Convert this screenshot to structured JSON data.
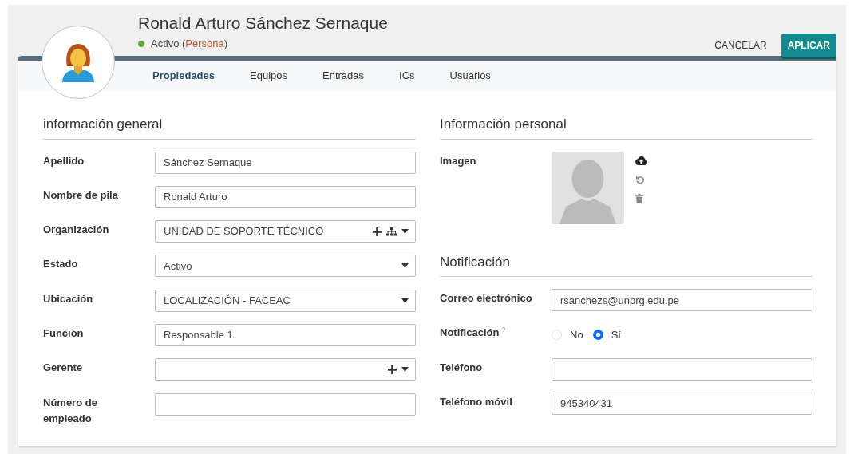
{
  "header": {
    "name": "Ronald Arturo Sánchez Sernaque",
    "status": {
      "text": "Activo",
      "color": "#6aaa3a"
    },
    "type": {
      "open": "(",
      "text": "Persona",
      "close": ")"
    }
  },
  "buttons": [
    {
      "label": "CANCELAR",
      "kind": "link"
    },
    {
      "label": "APLICAR",
      "kind": "primary"
    }
  ],
  "tabs": [
    {
      "label": "Propiedades",
      "selected": true
    },
    {
      "label": "Equipos",
      "selected": false
    },
    {
      "label": "Entradas",
      "selected": false
    },
    {
      "label": "ICs",
      "selected": false
    },
    {
      "label": "Usuarios",
      "selected": false
    }
  ],
  "columns": [
    {
      "sections": [
        {
          "title": "información general",
          "fields": [
            {
              "label": "Apellido",
              "kind": "text",
              "value": "Sánchez Sernaque"
            },
            {
              "label": "Nombre de pila",
              "kind": "text",
              "value": "Ronald Arturo"
            },
            {
              "label": "Organización",
              "kind": "org-picker",
              "value": "UNIDAD DE SOPORTE TÉCNICO"
            },
            {
              "label": "Estado",
              "kind": "select",
              "value": "Activo"
            },
            {
              "label": "Ubicación",
              "kind": "select",
              "value": "LOCALIZACIÓN - FACEAC"
            },
            {
              "label": "Función",
              "kind": "text",
              "value": "Responsable 1"
            },
            {
              "label": "Gerente",
              "kind": "person-picker"
            },
            {
              "label": "Número de empleado",
              "kind": "text"
            }
          ]
        }
      ]
    },
    {
      "sections": [
        {
          "title": "Información personal",
          "fields": [
            {
              "label": "Imagen",
              "kind": "image"
            }
          ]
        },
        {
          "title": "Notificación",
          "fields": [
            {
              "label": "Correo electrónico",
              "kind": "text",
              "value": "rsanchezs@unprg.edu.pe"
            },
            {
              "label": "Notificación",
              "kind": "radio",
              "help": "?",
              "options": [
                {
                  "label": "No",
                  "selected": false
                },
                {
                  "label": "Sí",
                  "selected": true
                }
              ]
            },
            {
              "label": "Teléfono",
              "kind": "text"
            },
            {
              "label": "Teléfono móvil",
              "kind": "text",
              "value": "945340431"
            }
          ]
        }
      ]
    }
  ]
}
